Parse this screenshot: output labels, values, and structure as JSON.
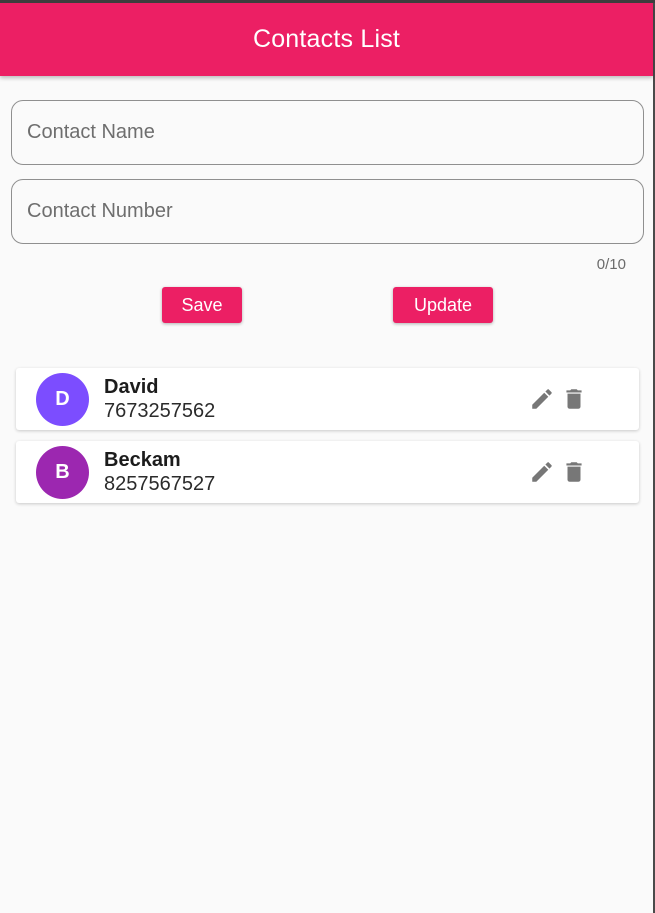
{
  "app_bar": {
    "title": "Contacts List",
    "color": "#ec1f64"
  },
  "form": {
    "name_placeholder": "Contact Name",
    "number_placeholder": "Contact Number",
    "counter": "0/10",
    "save_label": "Save",
    "update_label": "Update"
  },
  "contacts": [
    {
      "initial": "D",
      "name": "David",
      "number": "7673257562",
      "avatar_color": "#7c4dff",
      "edit_icon": "pencil-icon",
      "delete_icon": "trash-icon"
    },
    {
      "initial": "B",
      "name": "Beckam",
      "number": "8257567527",
      "avatar_color": "#9c27b0",
      "edit_icon": "pencil-icon",
      "delete_icon": "trash-icon"
    }
  ]
}
